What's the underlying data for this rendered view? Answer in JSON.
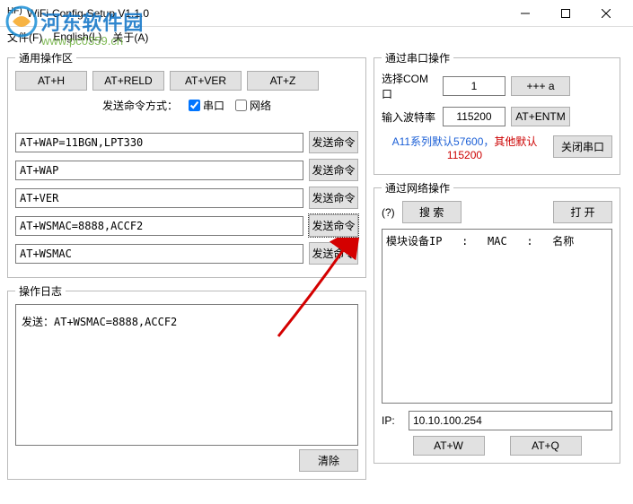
{
  "window": {
    "icon": "HF)",
    "title": "WiFi-Config-Setup V1.1.0"
  },
  "menu": {
    "file": "文件(F)",
    "lang": "English(L)",
    "about": "关于(A)"
  },
  "watermark": {
    "big": "河东软件园",
    "small": "www.pc0359.cn"
  },
  "left": {
    "groupTitle": "通用操作区",
    "topButtons": [
      "AT+H",
      "AT+RELD",
      "AT+VER",
      "AT+Z"
    ],
    "sendWayLabel": "发送命令方式：",
    "serialChk": "串口",
    "netChk": "网络",
    "serialChecked": true,
    "netChecked": false,
    "cmds": [
      "AT+WAP=11BGN,LPT330",
      "AT+WAP",
      "AT+VER",
      "AT+WSMAC=8888,ACCF2",
      "AT+WSMAC"
    ],
    "sendBtn": "发送命令",
    "logTitle": "操作日志",
    "logText": "发送：AT+WSMAC=8888,ACCF2",
    "clearBtn": "清除"
  },
  "serial": {
    "groupTitle": "通过串口操作",
    "comLabel": "选择COM口",
    "comValue": "1",
    "btnA": "+++ a",
    "baudLabel": "输入波特率",
    "baudValue": "115200",
    "btnEntm": "AT+ENTM",
    "note1": "A11系列默认57600，",
    "note2": "其他默认115200",
    "closeBtn": "关闭串口"
  },
  "net": {
    "groupTitle": "通过网络操作",
    "q": "(?)",
    "searchBtn": "搜 索",
    "openBtn": "打 开",
    "header": "模块设备IP   :   MAC   :   名称",
    "ipLabel": "IP:",
    "ipValue": "10.10.100.254",
    "btnW": "AT+W",
    "btnQ": "AT+Q"
  }
}
